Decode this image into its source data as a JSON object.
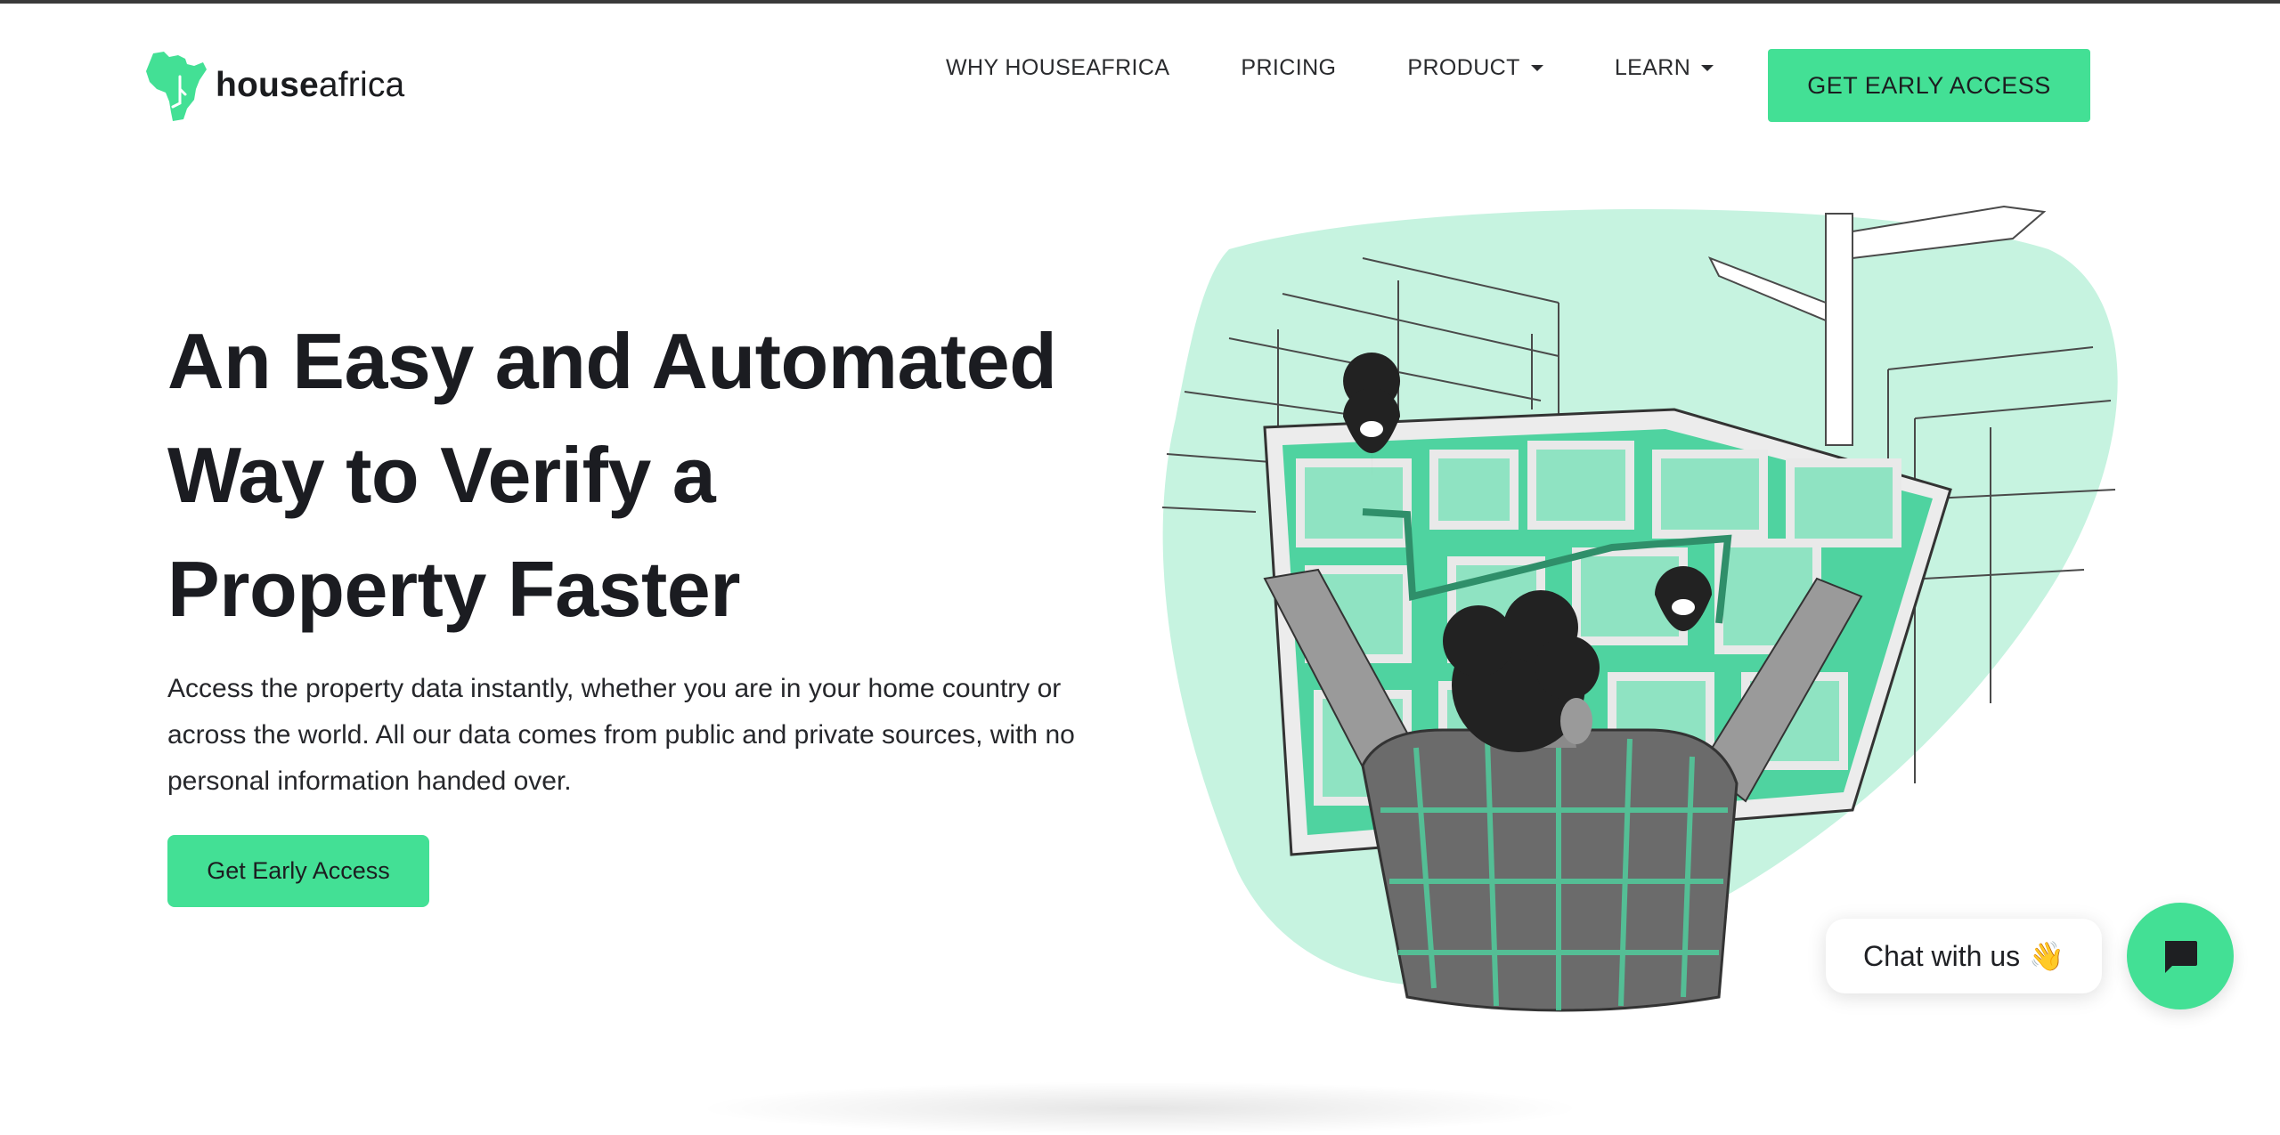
{
  "brand": {
    "name_bold": "house",
    "name_light": "africa",
    "accent_color": "#43e095"
  },
  "nav": {
    "items": [
      {
        "label": "WHY HOUSEAFRICA",
        "has_dropdown": false
      },
      {
        "label": "PRICING",
        "has_dropdown": false
      },
      {
        "label": "PRODUCT",
        "has_dropdown": true
      },
      {
        "label": "LEARN",
        "has_dropdown": true
      }
    ],
    "cta_label": "GET EARLY ACCESS"
  },
  "hero": {
    "title_lines": [
      "An Easy and Automated",
      "Way to Verify a",
      "Property Faster"
    ],
    "description": "Access the property data instantly, whether you are in your home country or across the world. All our data comes from public and private sources, with no personal information handed over.",
    "cta_label": "Get Early Access",
    "illustration_icon": "person-holding-map-illustration"
  },
  "chat": {
    "bubble_text": "Chat with us",
    "emoji": "👋",
    "button_icon": "chat-bubble-icon"
  }
}
